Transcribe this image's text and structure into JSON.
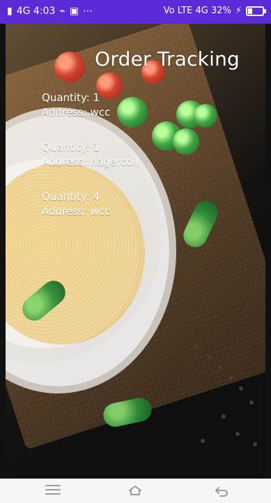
{
  "status_bar": {
    "left_text": "4G 4:03",
    "left_icons": [
      "signal-icon",
      "usb-icon",
      "notification-icon",
      "more-icon"
    ],
    "right_text": "Vo LTE 4G 32%",
    "battery_percent": 32,
    "battery_icon": "battery-icon",
    "charging_icon": "charging-icon"
  },
  "page": {
    "title": "Order Tracking",
    "orders": [
      {
        "quantity_label": "Quantity: 1",
        "address_label": "Address: wcc"
      },
      {
        "quantity_label": "Quantity: 1",
        "address_label": "Address: nagercoil"
      },
      {
        "quantity_label": "Quantity: 4",
        "address_label": "Address: wcc"
      }
    ]
  },
  "nav_bar": {
    "left_icon": "menu-icon",
    "center_icon": "home-icon",
    "right_icon": "back-icon"
  },
  "colors": {
    "status_bar_bg": "#5a2bd6",
    "nav_bar_bg": "#f6f6f6",
    "text": "#ffffff"
  }
}
